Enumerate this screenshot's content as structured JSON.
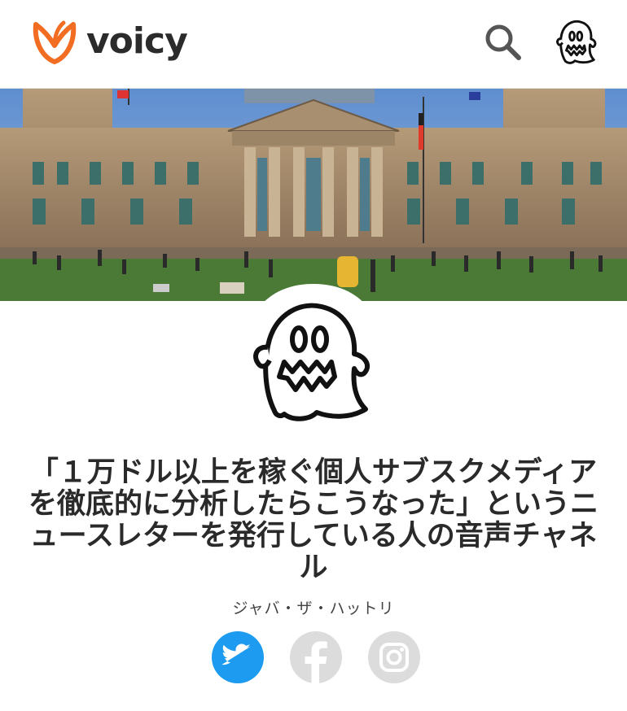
{
  "app": {
    "brand": "voicy",
    "brand_color": "#f26c21"
  },
  "header": {
    "icons": [
      "voicy-logo-icon",
      "search-icon",
      "user-avatar-ghost-icon"
    ]
  },
  "channel": {
    "title": "「１万ドル以上を稼ぐ個人サブスクメディアを徹底的に分析したらこうなった」というニュースレターを発行している人の音声チャネル",
    "author": "ジャバ・ザ・ハットリ",
    "cover_image": "reichstag-building-photo",
    "avatar": "ghost-icon"
  },
  "social": {
    "twitter_color": "#1d9bf0",
    "facebook_color": "#dcdcdc",
    "instagram_color": "#dcdcdc",
    "icons": [
      "twitter-icon",
      "facebook-icon",
      "instagram-icon"
    ]
  }
}
